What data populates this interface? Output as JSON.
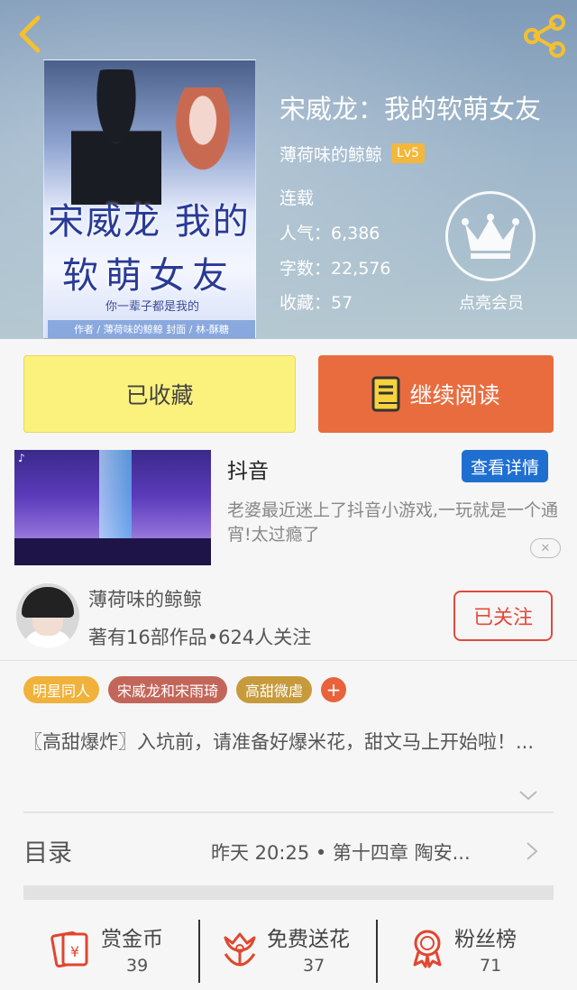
{
  "header": {
    "book_title": "宋威龙：我的软萌女友",
    "author": "薄荷味的鲸鲸",
    "level": "Lv5",
    "status": "连载",
    "popularity": "人气：6,386",
    "word_count": "字数：22,576",
    "favorites": "收藏：57",
    "vip_label": "点亮会员",
    "cover": {
      "title_line1": "宋威龙 我的",
      "title_line2": "软萌女友",
      "tagline": "你一辈子都是我的",
      "credit": "作者 / 薄荷味的鲸鲸 封面 / 林-酥糖"
    }
  },
  "actions": {
    "collected_label": "已收藏",
    "read_label": "继续阅读"
  },
  "ad": {
    "title": "抖音",
    "detail_label": "查看详情",
    "description": "老婆最近迷上了抖音小游戏,一玩就是一个通宵!太过瘾了",
    "close_symbol": "✕"
  },
  "author_card": {
    "name": "薄荷味的鲸鲸",
    "meta": "著有16部作品•624人关注",
    "follow_label": "已关注"
  },
  "tags": [
    {
      "label": "明星同人",
      "color": "#f0b23a"
    },
    {
      "label": "宋威龙和宋雨琦",
      "color": "#c3665a"
    },
    {
      "label": "高甜微虐",
      "color": "#c79a3c"
    }
  ],
  "tag_add": "+",
  "intro": "〖高甜爆炸〗入坑前，请准备好爆米花，甜文马上开始啦！...",
  "toc": {
    "label": "目录",
    "latest": "昨天 20:25 • 第十四章 陶安..."
  },
  "bottom": {
    "reward": {
      "label": "赏金币",
      "count": "39"
    },
    "flowers": {
      "label": "免费送花",
      "count": "37"
    },
    "fans": {
      "label": "粉丝榜",
      "count": "71"
    }
  },
  "colors": {
    "accent": "#e96c3f",
    "collected": "#fbf27e",
    "follow": "#e24a3a",
    "ad_button": "#1f6fd1",
    "icon_red": "#e2452f"
  }
}
